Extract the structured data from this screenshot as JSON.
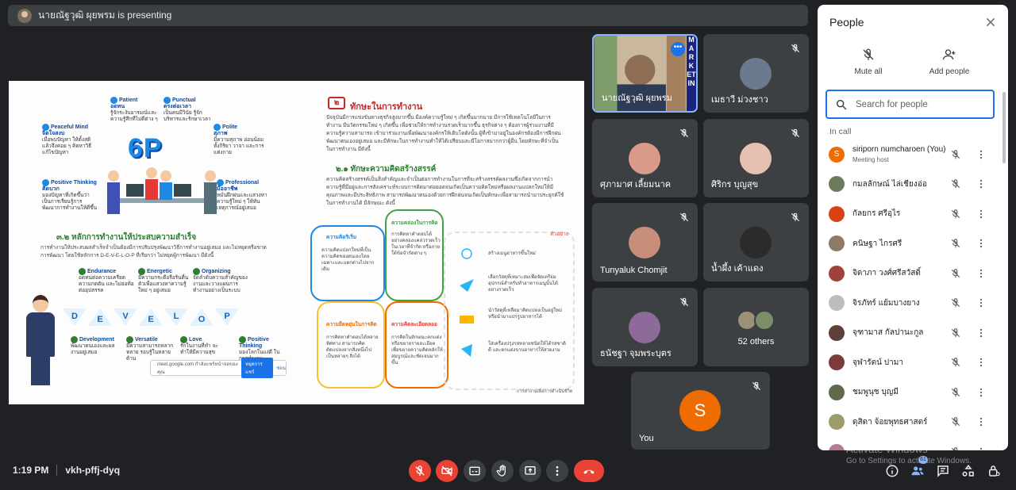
{
  "presenter": {
    "text": "นายณัฐวุฒิ ผุยพรม is presenting"
  },
  "slide": {
    "left_title": "๓.๒ หลักการทำงานให้ประสบความสำเร็จ",
    "left_para": "การทำงานให้ประสบผลสำเร็จจำเป็นต้องมีการปรับปรุงพัฒนาวิธีการทำงานอยู่เสมอ และไม่หยุดหรือขาดการพัฒนา โดยใช้หลักการ D-E-V-E-L-O-P ที่เรียกว่า ไม่หยุดผู้การพัฒนา มีดังนี้",
    "big_6p": "6P",
    "p_items": [
      {
        "title": "Patient",
        "sub": "อดทน",
        "desc": "รู้จักระงับอารมณ์และความรู้สึกที่ไม่ดีต่าง ๆ"
      },
      {
        "title": "Punctual",
        "sub": "ตรงต่อเวลา",
        "desc": "เป็นคนมีวินัย รู้จักบริหารและรักษาเวลา"
      },
      {
        "title": "Peaceful Mind",
        "sub": "จิตใจสงบ",
        "desc": "เมื่อพบปัญหา ให้ตั้งสติ แล้วจึงค่อย ๆ คิดหาวิธีแก้ไขปัญหา"
      },
      {
        "title": "Polite",
        "sub": "สุภาพ",
        "desc": "มีความสุภาพ อ่อนน้อมทั้งกิริยา วาจา และการแต่งกาย"
      },
      {
        "title": "Positive Thinking",
        "sub": "คิดบวก",
        "desc": "มองปัญหาที่เกิดขึ้นว่าเป็นการเรียนรู้การพัฒนาการทำงานให้ดีขึ้น"
      },
      {
        "title": "Professional",
        "sub": "มืออาชีพ",
        "desc": "หมั่นฝึกฝนและแสวงหาความรู้ใหม่ ๆ ให้ทันเหตุการณ์อยู่เสมอ"
      }
    ],
    "develop_letters": [
      "D",
      "E",
      "V",
      "E",
      "L",
      "O",
      "P"
    ],
    "develop_items": [
      {
        "title": "Endurance",
        "desc": "อดทนต่อความเครียด ความกดดัน และไม่ย่อท้อต่ออุปสรรค"
      },
      {
        "title": "Energetic",
        "desc": "มีความกระตือรือร้นตื่นตัวเพื่อแสวงหาความรู้ใหม่ ๆ อยู่เสมอ"
      },
      {
        "title": "Organizing",
        "desc": "จัดลำดับความสำคัญของงานและวางแผนการทำงานอย่างเป็นระบบ"
      },
      {
        "title": "Development",
        "desc": "พัฒนาตนเองและผลงานอยู่เสมอ"
      },
      {
        "title": "Versatile",
        "desc": "มีความสามารถหลากหลาย รอบรู้ในหลายด้าน"
      },
      {
        "title": "Love",
        "desc": "รักในงานที่ทำ จะทำให้มีความสุข"
      },
      {
        "title": "Positive Thinking",
        "desc": "มองโลกในแง่ดี ในการทำงาน"
      }
    ],
    "tooltip_text": "meet.google.com กำลังแชร์หน้าจอของคุณ",
    "tooltip_share": "หยุดการแชร์",
    "tooltip_hide": "ซ่อน",
    "right_num": "๒",
    "right_title": "ทักษะในการทำงาน",
    "right_para": "ปัจจุบันมีการแข่งขันทางธุรกิจสูงมากขึ้น มีองค์ความรู้ใหม่ ๆ เกิดขึ้นมากมาย มีการใช้เทคโนโลยีในการทำงาน มีนวัตกรรมใหม่ ๆ เกิดขึ้น เพื่อช่วยให้การทำงานรวดเร็วมากขึ้น ธุรกิจต่าง ๆ ต้องการผู้ร่วมงานที่มีความรู้ความสามารถ เข้ามาร่วมงานเพื่อพัฒนาองค์กรให้เติบโตดังนั้น ผู้ที่เข้ามาอยู่ในองค์กรต้องมีการฝึกฝนพัฒนาตนเองอยู่เสมอ และมีทักษะในการทำงานทำให้ได้เปรียบและมีโอกาสมากกว่าผู้อื่น โดยทักษะที่จำเป็นในการทำงาน มีดังนี้",
    "right_sub_title": "๒.๑ ทักษะความคิดสร้างสรรค์",
    "right_sub_para": "ความคิดสร้างสรรค์เป็นสิ่งสำคัญและจำเป็นต่อการทำงานในการที่จะสร้างสรรค์ผลงานซึ่งเกิดจากการนำความรู้ที่มีอยู่และการสังเคราะห์ระบบการคิดมาต่อยอดจนเกิดเป็นความคิดใหม่หรือผลงานแปลกใหม่ให้มีคุณภาพและมีประสิทธิภาพ สามารถพัฒนาตนเองด้วยการฝึกฝนจนเกิดเป็นทักษะเพื่อสามารถนำมาประยุกต์ใช้ในการทำงานได้ มีลักษณะ ดังนี้",
    "brain": [
      {
        "title": "ความคิดริเริ่ม",
        "desc": "ความคิดแปลกใหม่ที่เป็นความคิดของตนเองโดยเฉพาะและแตกต่างไปจากเดิม"
      },
      {
        "title": "ความคล่องในการคิด",
        "desc": "การคิดหาคำตอบได้อย่างคล่องแคล่วรวดเร็วในเวลาที่จำกัด หรือภายใต้ข้อจำกัดต่าง ๆ"
      },
      {
        "title": "ความยืดหยุ่นในการคิด",
        "desc": "การคิดหาคำตอบได้หลายทิศทาง สามารถคิดดัดแปลงจากสิ่งหนึ่งไปเป็นหลายๆ สิ่งได้"
      },
      {
        "title": "ความคิดละเอียดลออ",
        "desc": "การคิดในลักษณะตกแต่งหรือขยายรายละเอียด เพื่อขยายความคิดหลักให้สมบูรณ์และชัดเจนมากขึ้น"
      }
    ],
    "example_label": "ตัวอย่าง",
    "examples": [
      "สร้างเมนูอาหารขึ้นใหม่",
      "เลือกวัสดุที่เหมาะสมเพื่อจัดเตรียมอุปกรณ์สำหรับทำอาหารเมนูนั้นได้อย่างรวดเร็ว",
      "นำวัสดุที่เหลือมาคิดแปลงเป็นอยู่ใหม่หรือนำมาแปรรูปอาหารได้",
      "ใส่เครื่องปรุงรสหลายชนิดให้ได้รสชาติดี และตกแต่งจานอาหารให้สวยงาม"
    ],
    "footer_note": "การทำงานเพื่อการดำเนินชีวิต"
  },
  "tiles": [
    {
      "name": "นายณัฐวุฒิ ผุยพรม",
      "side_text": "MARKETIN"
    },
    {
      "name": "เมธาวี ม่วงชาว"
    },
    {
      "name": "ศุภามาศ เลี้ยมนาค"
    },
    {
      "name": "ศิริกร บุญสุข"
    },
    {
      "name": "Tunyaluk Chomjit"
    },
    {
      "name": "น้ำผึ้ง เค้าแดง"
    },
    {
      "name": "ธนัชฐา จุมพระบุตร"
    },
    {
      "name": "52 others"
    },
    {
      "name": "You",
      "initial": "S"
    }
  ],
  "panel": {
    "title": "People",
    "mute_all": "Mute all",
    "add_people": "Add people",
    "search_placeholder": "Search for people",
    "in_call": "In call",
    "participants": [
      {
        "name": "siriporn numcharoen (You)",
        "sub": "Meeting host",
        "initial": "S",
        "color": "#ef6c00"
      },
      {
        "name": "กมลลักษณ์ ไล่เชียงอ่อ",
        "color": "#6d7b5c"
      },
      {
        "name": "กัลยกร ศรีอุไร",
        "color": "#d84315"
      },
      {
        "name": "คนิษฐา ไกรศรี",
        "color": "#8d7b68"
      },
      {
        "name": "จิดาภา วงศ์ศรีสวัสดิ์",
        "color": "#a0413b"
      },
      {
        "name": "จิรภัทร์ แย้มบางยาง",
        "color": "#bdbdbd"
      },
      {
        "name": "จุฑามาส กัลปานะกูล",
        "color": "#5d4037"
      },
      {
        "name": "จุฬารัตน์ ปามา",
        "color": "#7b3b3b"
      },
      {
        "name": "ชมพูนุช บุญมี",
        "color": "#5e6b4a"
      },
      {
        "name": "ดุสิดา จ้อยพุทธศาสตร์",
        "color": "#9e9d6a"
      },
      {
        "name": "",
        "color": "#b37b8f"
      }
    ]
  },
  "bottom": {
    "time": "1:19 PM",
    "code": "vkh-pffj-dyq",
    "people_count": "61"
  },
  "watermark": {
    "title": "Activate Windows",
    "sub": "Go to Settings to activate Windows."
  }
}
